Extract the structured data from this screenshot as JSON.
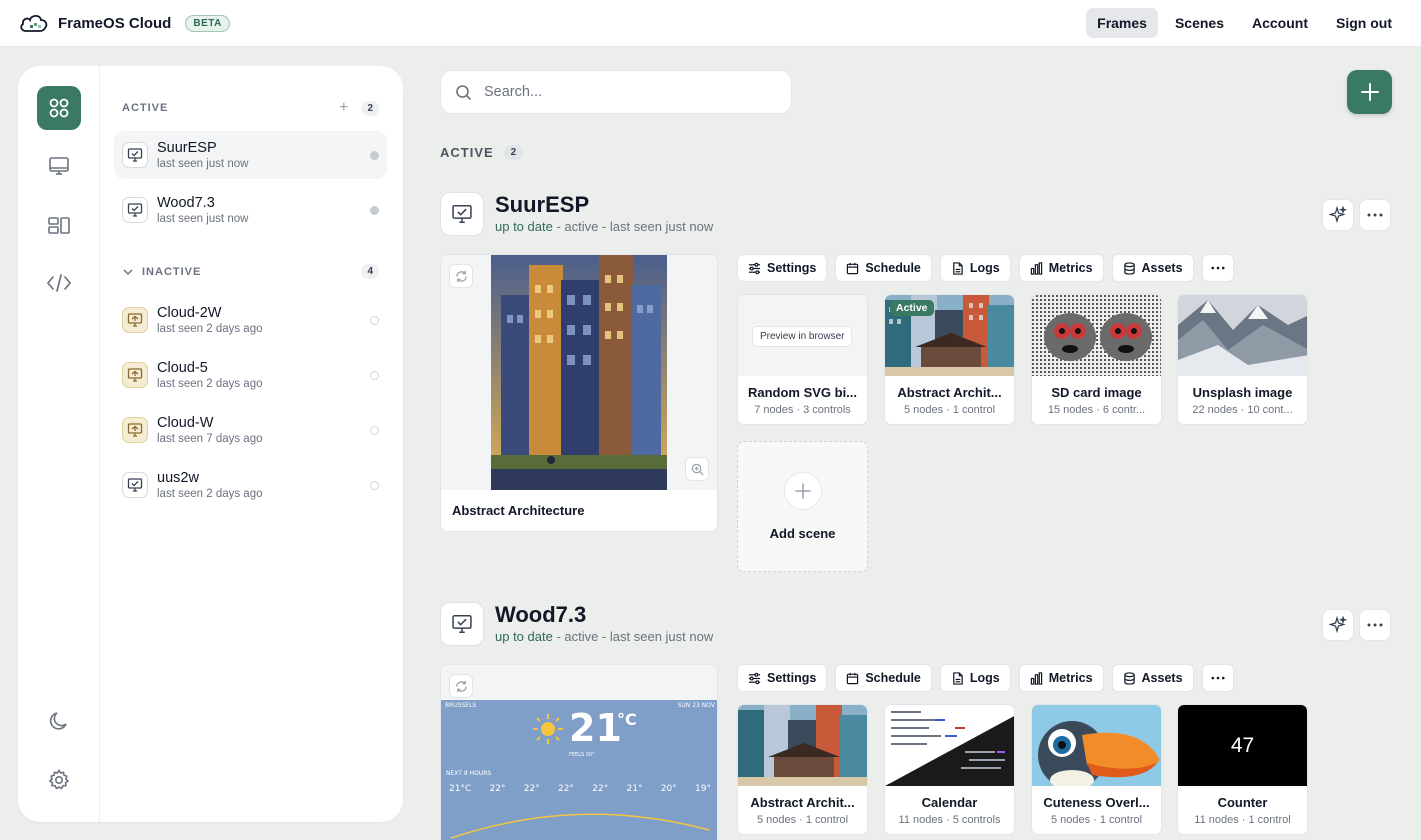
{
  "app": {
    "title": "FrameOS Cloud",
    "badge": "BETA"
  },
  "topnav": {
    "frames": "Frames",
    "scenes": "Scenes",
    "account": "Account",
    "sign_out": "Sign out",
    "active_item": "Frames"
  },
  "rail": [
    "grid-icon",
    "monitor-icon",
    "layout-icon",
    "code-icon",
    "moon-icon",
    "gear-icon"
  ],
  "sidebar": {
    "active_label": "ACTIVE",
    "active_count": "2",
    "inactive_label": "INACTIVE",
    "inactive_count": "4",
    "active_frames": [
      {
        "name": "SuurESP",
        "sub": "last seen just now"
      },
      {
        "name": "Wood7.3",
        "sub": "last seen just now"
      }
    ],
    "inactive_frames": [
      {
        "name": "Cloud-2W",
        "sub": "last seen 2 days ago"
      },
      {
        "name": "Cloud-5",
        "sub": "last seen 2 days ago"
      },
      {
        "name": "Cloud-W",
        "sub": "last seen 7 days ago"
      },
      {
        "name": "uus2w",
        "sub": "last seen 2 days ago"
      }
    ]
  },
  "search": {
    "placeholder": "Search...",
    "value": ""
  },
  "main": {
    "active_label": "ACTIVE",
    "active_count": "2",
    "toolbar": {
      "settings": "Settings",
      "schedule": "Schedule",
      "logs": "Logs",
      "metrics": "Metrics",
      "assets": "Assets"
    },
    "frames": [
      {
        "name": "SuurESP",
        "status_ok": "up to date",
        "status_rest": " - active - last seen just now",
        "preview_caption": "Abstract Architecture",
        "scenes": [
          {
            "name": "Random SVG bi...",
            "meta": "7 nodes · 3 controls",
            "pill": "Preview in browser"
          },
          {
            "name": "Abstract Archit...",
            "meta": "5 nodes · 1 control",
            "tag": "Active"
          },
          {
            "name": "SD card image",
            "meta": "15 nodes · 6 contr..."
          },
          {
            "name": "Unsplash image",
            "meta": "22 nodes · 10 cont..."
          }
        ],
        "add_scene": "Add scene"
      },
      {
        "name": "Wood7.3",
        "status_ok": "up to date",
        "status_rest": " - active - last seen just now",
        "weather": {
          "city": "BRUSSELS",
          "date": "SUN 23 NOV",
          "temp": "21",
          "unit": "°C",
          "note": "FEELS 20°",
          "next": "NEXT 8 HOURS",
          "hours": [
            "21°C",
            "22°",
            "22°",
            "22°",
            "22°",
            "21°",
            "20°",
            "19°"
          ]
        },
        "scenes": [
          {
            "name": "Abstract Archit...",
            "meta": "5 nodes · 1 control"
          },
          {
            "name": "Calendar",
            "meta": "11 nodes · 5 controls"
          },
          {
            "name": "Cuteness Overl...",
            "meta": "5 nodes · 1 control"
          },
          {
            "name": "Counter",
            "meta": "11 nodes · 1 control",
            "value": "47"
          }
        ]
      }
    ]
  },
  "colors": {
    "accent": "#3b7a62",
    "status_ok": "#2f6b55",
    "background": "#eceeeb"
  }
}
